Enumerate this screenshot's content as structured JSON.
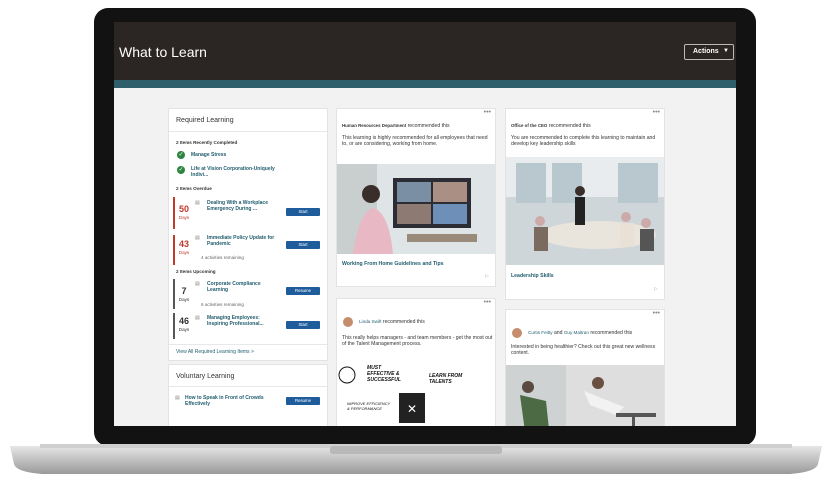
{
  "header": {
    "title": "What to Learn",
    "actions_label": "Actions"
  },
  "required": {
    "title": "Required Learning",
    "completed_heading": "2 Items Recently Completed",
    "completed": [
      "Manage Stress",
      "Life at Vision Corporation-Uniquely Indivi..."
    ],
    "overdue_heading": "2 Items Overdue",
    "overdue": [
      {
        "days": "50",
        "unit": "Days",
        "title": "Dealing With a Workplace Emergency During ...",
        "button": "Start",
        "note": ""
      },
      {
        "days": "43",
        "unit": "Days",
        "title": "Immediate Policy Update for Pandemic",
        "button": "Start",
        "note": "4 activities remaining"
      }
    ],
    "upcoming_heading": "2 Items Upcoming",
    "upcoming": [
      {
        "days": "7",
        "unit": "Days",
        "title": "Corporate Compliance Learning",
        "button": "Resume",
        "note": "6 activities remaining"
      },
      {
        "days": "46",
        "unit": "Days",
        "title": "Managing Employees: Inspiring Professional...",
        "button": "Start",
        "note": ""
      }
    ],
    "view_all": "View All Required Learning Items >"
  },
  "voluntary": {
    "title": "Voluntary Learning",
    "items": [
      {
        "title": "How to Speak in Front of Crowds Effectively",
        "button": "Resume"
      }
    ]
  },
  "feed": [
    {
      "author": "Human Resources Department",
      "suffix": "recommended this",
      "text": "This learning is highly recommended for all employees that need to, or are considering, working from home.",
      "title": "Working From Home Guidelines and Tips"
    },
    {
      "author": "Office of the CEO",
      "suffix": "recommended this",
      "text": "You are recommended to complete this learning to maintain and develop key leadership skills",
      "title": "Leadership Skills"
    },
    {
      "author": "Linda Swift",
      "suffix": "recommended this",
      "text": "This really helps managers - and team members - get the most out of the Talent Management process.",
      "illustration": [
        "MUST EFFECTIVE & SUCCESSFUL",
        "LEARN FROM TALENTS",
        "IMPROVE EFFICIENCY & PERFORMANCE"
      ]
    },
    {
      "author": "Curtis Feitty",
      "and": "and",
      "author2": "Guy Maltran",
      "suffix": "recommended this",
      "text": "Interested in being healthier? Check out this great new wellness content."
    }
  ],
  "icons": {
    "more": "more-horizontal-icon",
    "check": "check-circle-icon",
    "course": "course-icon"
  },
  "colors": {
    "header": "#2b2623",
    "accent": "#2f5f6a",
    "button": "#1e5c9b",
    "overdue": "#c0392b",
    "success": "#2e8540"
  }
}
